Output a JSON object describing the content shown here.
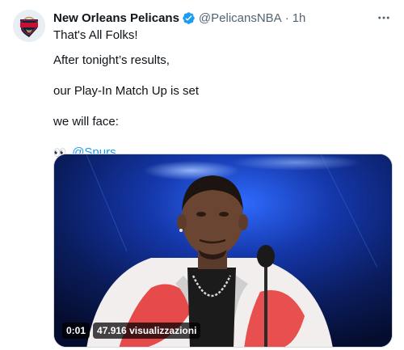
{
  "tweet": {
    "author": {
      "display_name": "New Orleans Pelicans",
      "handle": "@PelicansNBA",
      "verified": true,
      "avatar_icon": "pelicans-logo-icon"
    },
    "separator": "·",
    "time": "1h",
    "lines": [
      "That's All Folks!",
      "After tonight’s results,",
      "our Play-In Match Up is set",
      "we will face:"
    ],
    "mention": {
      "emoji": "👀",
      "text": "@Spurs"
    },
    "media": {
      "type": "video",
      "timestamp": "0:01",
      "views": "47.916 visualizzazioni"
    }
  },
  "colors": {
    "text": "#0f1419",
    "secondary": "#536471",
    "link": "#1d9bf0",
    "verified": "#1d9bf0"
  }
}
